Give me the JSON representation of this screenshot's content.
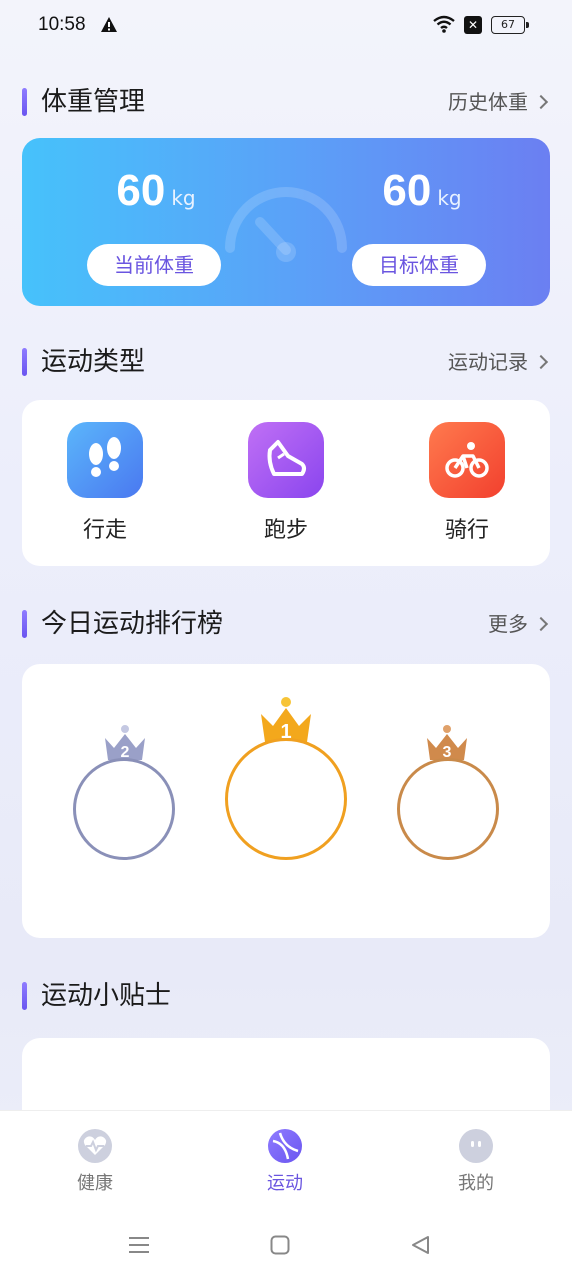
{
  "status_bar": {
    "time": "10:58",
    "battery": "67"
  },
  "weight_section": {
    "title": "体重管理",
    "more": "历史体重",
    "current_value": "60",
    "current_unit": "kg",
    "current_label": "当前体重",
    "target_value": "60",
    "target_unit": "kg",
    "target_label": "目标体重"
  },
  "sport_section": {
    "title": "运动类型",
    "more": "运动记录",
    "items": [
      {
        "label": "行走",
        "icon": "footprints-icon",
        "color": "#4f8df6"
      },
      {
        "label": "跑步",
        "icon": "running-shoe-icon",
        "color": "#a555f0"
      },
      {
        "label": "骑行",
        "icon": "bicycle-icon",
        "color": "#ff5a3c"
      }
    ]
  },
  "ranking_section": {
    "title": "今日运动排行榜",
    "more": "更多",
    "ranks": [
      {
        "rank": "2",
        "color": "#8a90b8"
      },
      {
        "rank": "1",
        "color": "#f0a020"
      },
      {
        "rank": "3",
        "color": "#c98a4a"
      }
    ]
  },
  "tips_section": {
    "title": "运动小贴士"
  },
  "bottom_nav": {
    "items": [
      {
        "label": "健康",
        "icon": "heart-pulse-icon"
      },
      {
        "label": "运动",
        "icon": "sport-ball-icon",
        "active": true
      },
      {
        "label": "我的",
        "icon": "smiley-icon"
      }
    ]
  }
}
